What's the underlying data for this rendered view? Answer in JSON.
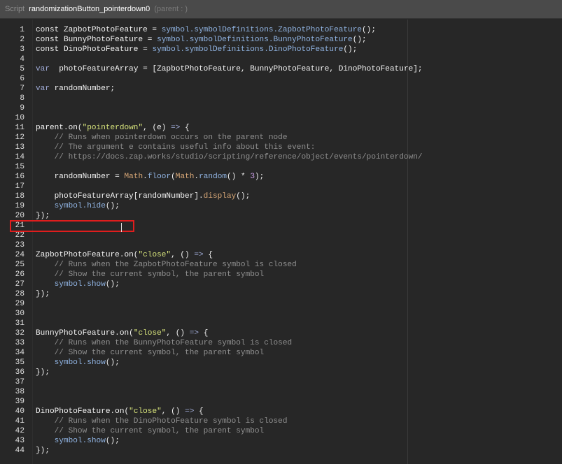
{
  "titlebar": {
    "label": "Script",
    "script_name": "randomizationButton_pointerdown0",
    "parent_label": "(parent : )"
  },
  "editor": {
    "highlighted_line": 19,
    "lines": [
      {
        "n": "1",
        "segs": [
          {
            "t": "const ZapbotPhotoFeature = "
          },
          {
            "t": "symbol.symbolDefinitions.ZapbotPhotoFeature",
            "c": "sym"
          },
          {
            "t": "();"
          }
        ]
      },
      {
        "n": "2",
        "segs": [
          {
            "t": "const BunnyPhotoFeature = "
          },
          {
            "t": "symbol.symbolDefinitions.BunnyPhotoFeature",
            "c": "sym"
          },
          {
            "t": "();"
          }
        ]
      },
      {
        "n": "3",
        "segs": [
          {
            "t": "const DinoPhotoFeature = "
          },
          {
            "t": "symbol.symbolDefinitions.DinoPhotoFeature",
            "c": "sym"
          },
          {
            "t": "();"
          }
        ]
      },
      {
        "n": "4",
        "segs": []
      },
      {
        "n": "5",
        "segs": [
          {
            "t": "var",
            "c": "k"
          },
          {
            "t": "  photoFeatureArray = [ZapbotPhotoFeature, BunnyPhotoFeature, DinoPhotoFeature];"
          }
        ]
      },
      {
        "n": "6",
        "segs": []
      },
      {
        "n": "7",
        "segs": [
          {
            "t": "var",
            "c": "k"
          },
          {
            "t": " randomNumber;"
          }
        ]
      },
      {
        "n": "8",
        "segs": []
      },
      {
        "n": "9",
        "segs": []
      },
      {
        "n": "10",
        "segs": []
      },
      {
        "n": "11",
        "segs": [
          {
            "t": "parent.on("
          },
          {
            "t": "\"pointerdown\"",
            "c": "s"
          },
          {
            "t": ", (e) "
          },
          {
            "t": "=>",
            "c": "k"
          },
          {
            "t": " {"
          }
        ]
      },
      {
        "n": "12",
        "segs": [
          {
            "t": "    // Runs when pointerdown occurs on the parent node",
            "c": "c"
          }
        ]
      },
      {
        "n": "13",
        "segs": [
          {
            "t": "    // The argument e contains useful info about this event:",
            "c": "c"
          }
        ]
      },
      {
        "n": "14",
        "segs": [
          {
            "t": "    // https://docs.zap.works/studio/scripting/reference/object/events/pointerdown/",
            "c": "c"
          }
        ]
      },
      {
        "n": "15",
        "segs": []
      },
      {
        "n": "16",
        "segs": [
          {
            "t": "    randomNumber = "
          },
          {
            "t": "Math",
            "c": "fn"
          },
          {
            "t": "."
          },
          {
            "t": "floor",
            "c": "sym"
          },
          {
            "t": "("
          },
          {
            "t": "Math",
            "c": "fn"
          },
          {
            "t": "."
          },
          {
            "t": "random",
            "c": "sym"
          },
          {
            "t": "() * "
          },
          {
            "t": "3",
            "c": "num"
          },
          {
            "t": ");"
          }
        ]
      },
      {
        "n": "17",
        "segs": []
      },
      {
        "n": "18",
        "segs": [
          {
            "t": "    photoFeatureArray[randomNumber]."
          },
          {
            "t": "display",
            "c": "fn"
          },
          {
            "t": "();"
          }
        ]
      },
      {
        "n": "19",
        "segs": [
          {
            "t": "    "
          },
          {
            "t": "symbol.hide",
            "c": "sym"
          },
          {
            "t": "();"
          }
        ]
      },
      {
        "n": "20",
        "segs": [
          {
            "t": "});"
          }
        ]
      },
      {
        "n": "21",
        "segs": []
      },
      {
        "n": "22",
        "segs": []
      },
      {
        "n": "23",
        "segs": []
      },
      {
        "n": "24",
        "segs": [
          {
            "t": "ZapbotPhotoFeature.on("
          },
          {
            "t": "\"close\"",
            "c": "s"
          },
          {
            "t": ", () "
          },
          {
            "t": "=>",
            "c": "k"
          },
          {
            "t": " {"
          }
        ]
      },
      {
        "n": "25",
        "segs": [
          {
            "t": "    // Runs when the ZapbotPhotoFeature symbol is closed",
            "c": "c"
          }
        ]
      },
      {
        "n": "26",
        "segs": [
          {
            "t": "    // Show the current symbol, the parent symbol",
            "c": "c"
          }
        ]
      },
      {
        "n": "27",
        "segs": [
          {
            "t": "    "
          },
          {
            "t": "symbol.show",
            "c": "sym"
          },
          {
            "t": "();"
          }
        ]
      },
      {
        "n": "28",
        "segs": [
          {
            "t": "});"
          }
        ]
      },
      {
        "n": "29",
        "segs": []
      },
      {
        "n": "30",
        "segs": []
      },
      {
        "n": "31",
        "segs": []
      },
      {
        "n": "32",
        "segs": [
          {
            "t": "BunnyPhotoFeature.on("
          },
          {
            "t": "\"close\"",
            "c": "s"
          },
          {
            "t": ", () "
          },
          {
            "t": "=>",
            "c": "k"
          },
          {
            "t": " {"
          }
        ]
      },
      {
        "n": "33",
        "segs": [
          {
            "t": "    // Runs when the BunnyPhotoFeature symbol is closed",
            "c": "c"
          }
        ]
      },
      {
        "n": "34",
        "segs": [
          {
            "t": "    // Show the current symbol, the parent symbol",
            "c": "c"
          }
        ]
      },
      {
        "n": "35",
        "segs": [
          {
            "t": "    "
          },
          {
            "t": "symbol.show",
            "c": "sym"
          },
          {
            "t": "();"
          }
        ]
      },
      {
        "n": "36",
        "segs": [
          {
            "t": "});"
          }
        ]
      },
      {
        "n": "37",
        "segs": []
      },
      {
        "n": "38",
        "segs": []
      },
      {
        "n": "39",
        "segs": []
      },
      {
        "n": "40",
        "segs": [
          {
            "t": "DinoPhotoFeature.on("
          },
          {
            "t": "\"close\"",
            "c": "s"
          },
          {
            "t": ", () "
          },
          {
            "t": "=>",
            "c": "k"
          },
          {
            "t": " {"
          }
        ]
      },
      {
        "n": "41",
        "segs": [
          {
            "t": "    // Runs when the DinoPhotoFeature symbol is closed",
            "c": "c"
          }
        ]
      },
      {
        "n": "42",
        "segs": [
          {
            "t": "    // Show the current symbol, the parent symbol",
            "c": "c"
          }
        ]
      },
      {
        "n": "43",
        "segs": [
          {
            "t": "    "
          },
          {
            "t": "symbol.show",
            "c": "sym"
          },
          {
            "t": "();"
          }
        ]
      },
      {
        "n": "44",
        "segs": [
          {
            "t": "});"
          }
        ]
      }
    ]
  }
}
